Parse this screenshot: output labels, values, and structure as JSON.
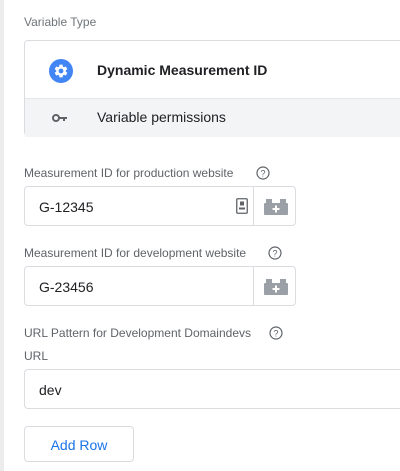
{
  "variable_type": {
    "section_label": "Variable Type",
    "type_name": "Dynamic Measurement ID",
    "type_icon": "gear-icon",
    "permissions_label": "Variable permissions",
    "permissions_icon": "key-icon"
  },
  "production": {
    "label": "Measurement ID for production website",
    "value": "G-12345"
  },
  "development": {
    "label": "Measurement ID for development website",
    "value": "G-23456"
  },
  "url_pattern": {
    "label": "URL Pattern for Development Domaindevs",
    "column_header": "URL",
    "value": "dev"
  },
  "add_row_label": "Add Row",
  "colors": {
    "accent": "#1a73e8",
    "icon_blue": "#4285f4",
    "border": "#dadce0",
    "muted_text": "#5f6368",
    "panel_bg": "#f3f4f5"
  }
}
